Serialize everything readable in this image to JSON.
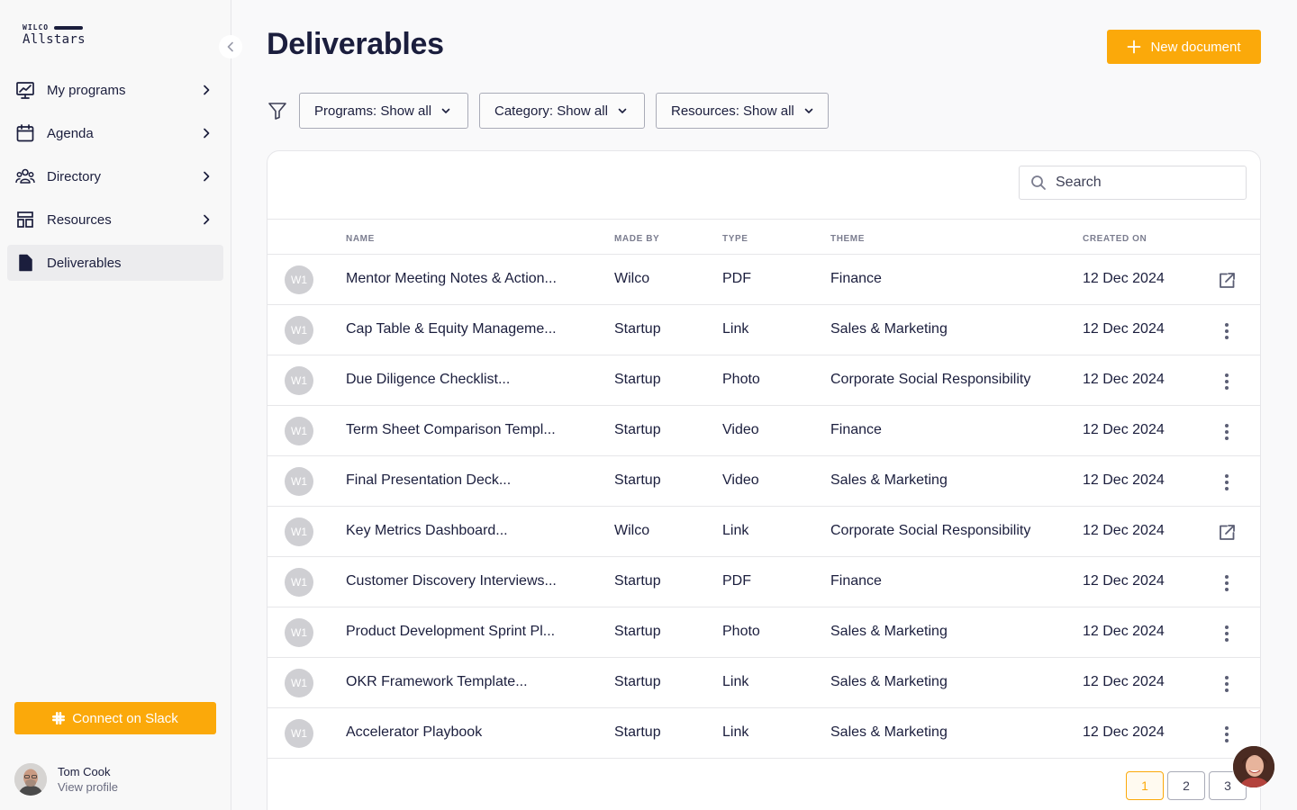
{
  "brand": {
    "small": "WILCO",
    "big": "Allstars"
  },
  "sidebar": {
    "items": [
      {
        "label": "My programs",
        "icon": "presentation-chart-icon",
        "chevron": true,
        "active": false
      },
      {
        "label": "Agenda",
        "icon": "calendar-icon",
        "chevron": true,
        "active": false
      },
      {
        "label": "Directory",
        "icon": "users-icon",
        "chevron": true,
        "active": false
      },
      {
        "label": "Resources",
        "icon": "layout-icon",
        "chevron": true,
        "active": false
      },
      {
        "label": "Deliverables",
        "icon": "document-icon",
        "chevron": false,
        "active": true
      }
    ],
    "slack_label": "Connect on Slack",
    "profile": {
      "name": "Tom Cook",
      "link": "View profile"
    }
  },
  "header": {
    "title": "Deliverables",
    "new_button": "New document"
  },
  "filters": [
    {
      "label": "Programs: Show all"
    },
    {
      "label": "Category: Show all"
    },
    {
      "label": "Resources: Show all"
    }
  ],
  "search": {
    "placeholder": "Search"
  },
  "table": {
    "columns": [
      "NAME",
      "MADE BY",
      "TYPE",
      "THEME",
      "CREATED ON"
    ],
    "rows": [
      {
        "avatar": "W1",
        "name": "Mentor Meeting Notes & Action...",
        "made_by": "Wilco",
        "type": "PDF",
        "theme": "Finance",
        "created": "12 Dec 2024",
        "action": "external-link-icon"
      },
      {
        "avatar": "W1",
        "name": "Cap Table & Equity Manageme...",
        "made_by": "Startup",
        "type": "Link",
        "theme": "Sales & Marketing",
        "created": "12 Dec 2024",
        "action": "more-vertical-icon"
      },
      {
        "avatar": "W1",
        "name": "Due Diligence Checklist...",
        "made_by": "Startup",
        "type": "Photo",
        "theme": "Corporate Social Responsibility",
        "created": "12 Dec 2024",
        "action": "more-vertical-icon"
      },
      {
        "avatar": "W1",
        "name": "Term Sheet Comparison Templ...",
        "made_by": "Startup",
        "type": "Video",
        "theme": "Finance",
        "created": "12 Dec 2024",
        "action": "more-vertical-icon"
      },
      {
        "avatar": "W1",
        "name": "Final Presentation Deck...",
        "made_by": "Startup",
        "type": "Video",
        "theme": "Sales & Marketing",
        "created": "12 Dec 2024",
        "action": "more-vertical-icon"
      },
      {
        "avatar": "W1",
        "name": "Key Metrics Dashboard...",
        "made_by": "Wilco",
        "type": "Link",
        "theme": "Corporate Social Responsibility",
        "created": "12 Dec 2024",
        "action": "external-link-icon"
      },
      {
        "avatar": "W1",
        "name": "Customer Discovery Interviews...",
        "made_by": "Startup",
        "type": "PDF",
        "theme": "Finance",
        "created": "12 Dec 2024",
        "action": "more-vertical-icon"
      },
      {
        "avatar": "W1",
        "name": "Product Development Sprint Pl...",
        "made_by": "Startup",
        "type": "Photo",
        "theme": "Sales & Marketing",
        "created": "12 Dec 2024",
        "action": "more-vertical-icon"
      },
      {
        "avatar": "W1",
        "name": "OKR Framework Template...",
        "made_by": "Startup",
        "type": "Link",
        "theme": "Sales & Marketing",
        "created": "12 Dec 2024",
        "action": "more-vertical-icon"
      },
      {
        "avatar": "W1",
        "name": "Accelerator Playbook",
        "made_by": "Startup",
        "type": "Link",
        "theme": "Sales & Marketing",
        "created": "12 Dec 2024",
        "action": "more-vertical-icon"
      }
    ]
  },
  "pagination": {
    "pages": [
      "1",
      "2",
      "3"
    ],
    "current": "1"
  },
  "colors": {
    "accent": "#fba90a",
    "text": "#1b1e3d",
    "border": "#e6e6e9"
  }
}
